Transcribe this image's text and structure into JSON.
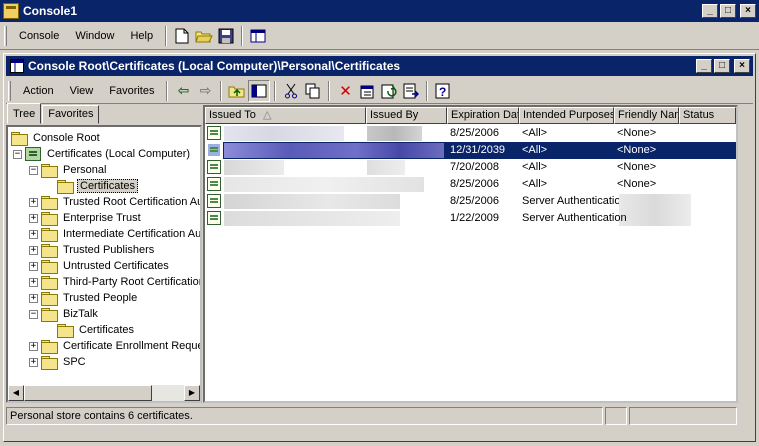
{
  "app_title": "Console1",
  "menu": {
    "console": "Console",
    "window": "Window",
    "help": "Help"
  },
  "inner_title": "Console Root\\Certificates (Local Computer)\\Personal\\Certificates",
  "inner_menu": {
    "action": "Action",
    "view": "View",
    "favorites": "Favorites"
  },
  "tabs": [
    "Tree",
    "Favorites"
  ],
  "tree": [
    {
      "label": "Console Root"
    },
    {
      "label": "Certificates (Local Computer)"
    },
    {
      "label": "Personal"
    },
    {
      "label": "Certificates"
    },
    {
      "label": "Trusted Root Certification Authoriti"
    },
    {
      "label": "Enterprise Trust"
    },
    {
      "label": "Intermediate Certification Authoriti"
    },
    {
      "label": "Trusted Publishers"
    },
    {
      "label": "Untrusted Certificates"
    },
    {
      "label": "Third-Party Root Certification Autho"
    },
    {
      "label": "Trusted People"
    },
    {
      "label": "BizTalk"
    },
    {
      "label": "Certificates"
    },
    {
      "label": "Certificate Enrollment Requests"
    },
    {
      "label": "SPC"
    }
  ],
  "columns": [
    "Issued To",
    "Issued By",
    "Expiration Date",
    "Intended Purposes",
    "Friendly Name",
    "Status"
  ],
  "sort_indicator": "△",
  "rows": [
    {
      "expiration": "8/25/2006",
      "purposes": "<All>",
      "friendly": "<None>"
    },
    {
      "expiration": "12/31/2039",
      "purposes": "<All>",
      "friendly": "<None>"
    },
    {
      "expiration": "7/20/2008",
      "purposes": "<All>",
      "friendly": "<None>"
    },
    {
      "expiration": "8/25/2006",
      "purposes": "<All>",
      "friendly": "<None>"
    },
    {
      "expiration": "8/25/2006",
      "purposes": "Server Authentication",
      "friendly": ""
    },
    {
      "expiration": "1/22/2009",
      "purposes": "Server Authentication",
      "friendly": ""
    }
  ],
  "status_text": "Personal store contains 6 certificates.",
  "colors": {
    "title_bar": "#0a246a",
    "selection": "#0a246a",
    "face": "#d4d0c8"
  }
}
